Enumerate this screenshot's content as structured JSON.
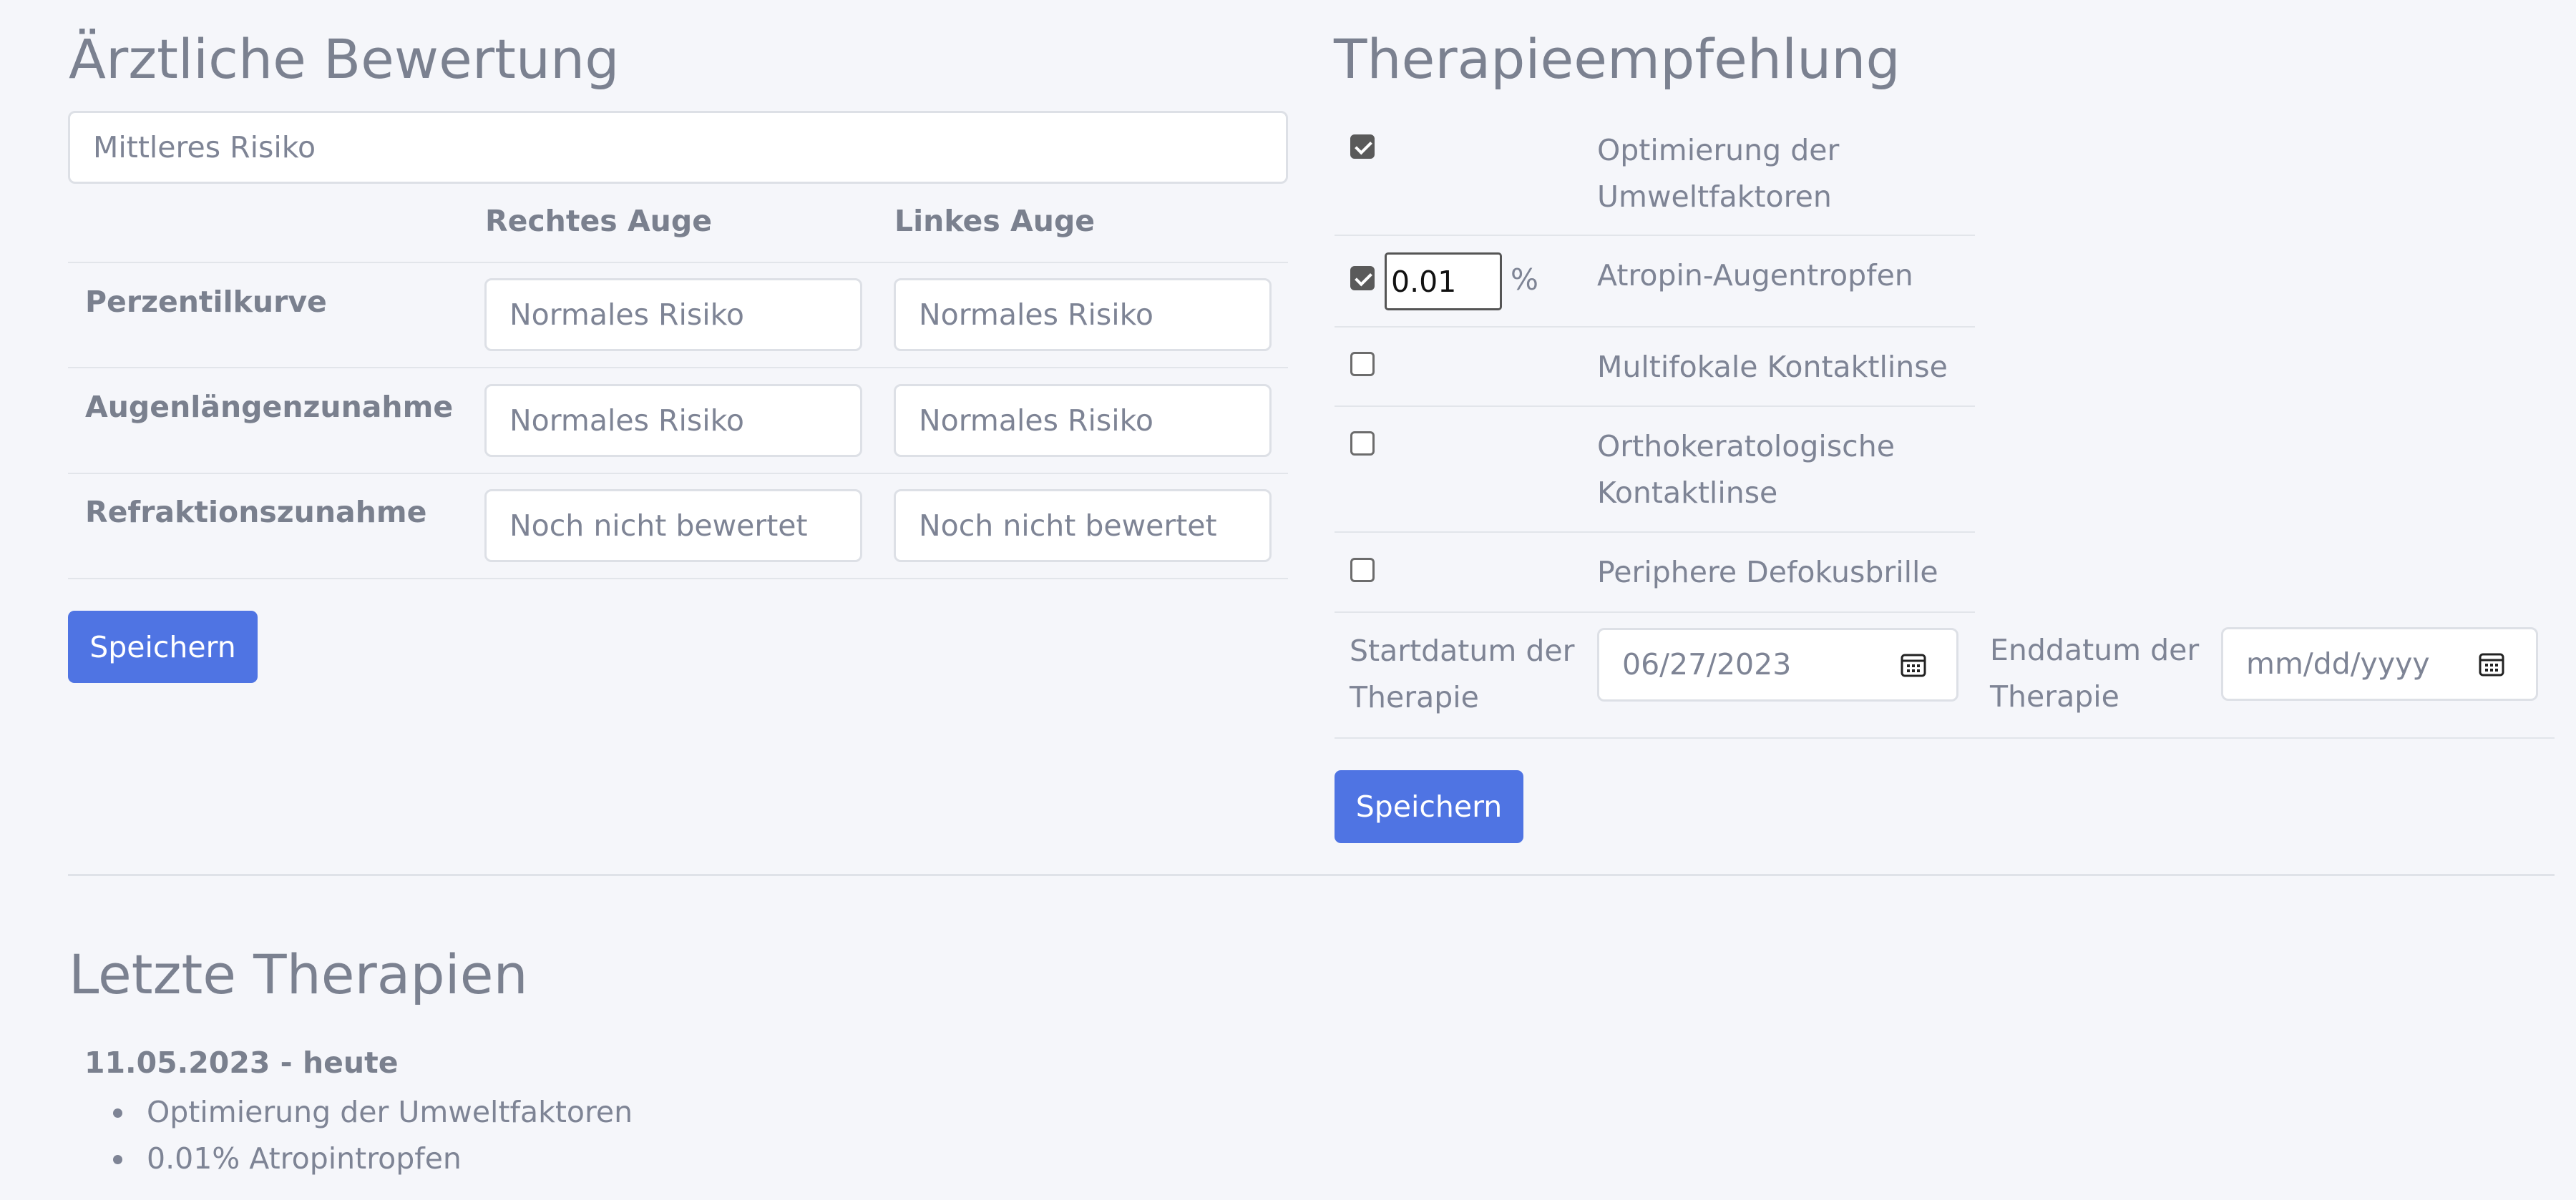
{
  "assessment": {
    "title": "Ärztliche Bewertung",
    "overall_value": "Mittleres Risiko",
    "col_right": "Rechtes Auge",
    "col_left": "Linkes Auge",
    "rows": [
      {
        "label": "Perzentilkurve",
        "right": "Normales Risiko",
        "left": "Normales Risiko"
      },
      {
        "label": "Augenlängenzunahme",
        "right": "Normales Risiko",
        "left": "Normales Risiko"
      },
      {
        "label": "Refraktionszunahme",
        "right": "Noch nicht bewertet",
        "left": "Noch nicht bewertet"
      }
    ],
    "save_label": "Speichern"
  },
  "therapy": {
    "title": "Therapieempfehlung",
    "items": [
      {
        "label_line1": "Optimierung der",
        "label_line2": "Umweltfaktoren",
        "checked": true
      },
      {
        "label_line1": "Atropin-Augentropfen",
        "label_line2": "",
        "checked": true,
        "dose": "0.01",
        "unit": "%"
      },
      {
        "label_line1": "Multifokale Kontaktlinse",
        "label_line2": "",
        "checked": false
      },
      {
        "label_line1": "Orthokeratologische",
        "label_line2": "Kontaktlinse",
        "checked": false
      },
      {
        "label_line1": "Periphere Defokusbrille",
        "label_line2": "",
        "checked": false
      }
    ],
    "start_label_line1": "Startdatum der",
    "start_label_line2": "Therapie",
    "start_value": "06/27/2023",
    "end_label_line1": "Enddatum der",
    "end_label_line2": "Therapie",
    "end_placeholder": "mm/dd/yyyy",
    "save_label": "Speichern"
  },
  "history": {
    "title": "Letzte Therapien",
    "range": "11.05.2023 - heute",
    "items": [
      "Optimierung der Umweltfaktoren",
      "0.01% Atropintropfen"
    ]
  },
  "icons": {
    "calendar": "calendar-icon"
  },
  "colors": {
    "primary": "#4f74e3",
    "background": "#f5f6fa"
  }
}
